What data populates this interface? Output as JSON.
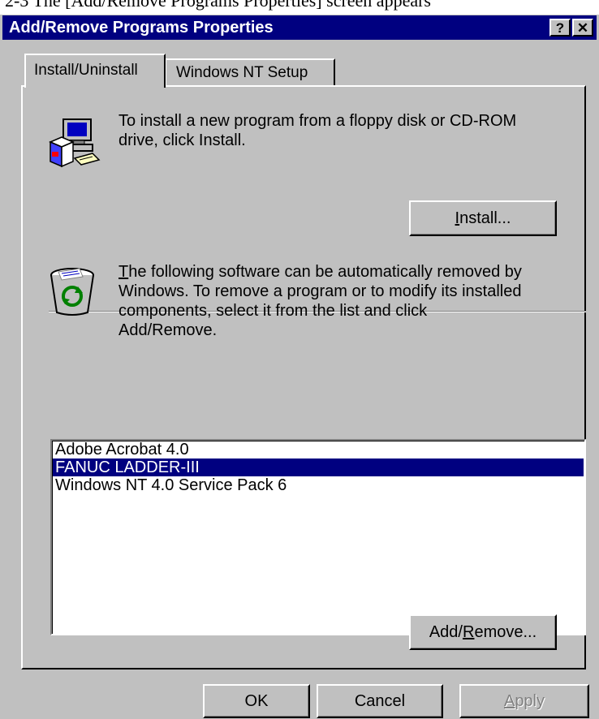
{
  "caption": "2-3    The [Add/Remove Programs Properties] screen appears",
  "window": {
    "title": "Add/Remove Programs Properties",
    "help_glyph": "?",
    "close_glyph": "✕"
  },
  "tabs": [
    {
      "label": "Install/Uninstall",
      "active": true
    },
    {
      "label": "Windows NT Setup",
      "active": false
    }
  ],
  "install_section": {
    "icon": "install-computer-icon",
    "text_line1": "To install a new program from a floppy disk or CD-ROM",
    "text_line2": "drive, click Install.",
    "button": {
      "prefix": "",
      "accel": "I",
      "suffix": "nstall..."
    }
  },
  "remove_section": {
    "icon": "recycle-bin-icon",
    "text_first_letter": "T",
    "text_line1_rest": "he following software can be automatically removed by",
    "text_line2": "Windows. To remove a program or to modify its installed",
    "text_line3": "components, select it from the list and click",
    "text_line4": "Add/Remove.",
    "programs": [
      {
        "name": "Adobe Acrobat 4.0",
        "selected": false
      },
      {
        "name": "FANUC LADDER-III",
        "selected": true
      },
      {
        "name": "Windows NT 4.0 Service Pack 6",
        "selected": false
      }
    ],
    "button": {
      "prefix": "Add/",
      "accel": "R",
      "suffix": "emove..."
    }
  },
  "footer": {
    "ok": "OK",
    "cancel": "Cancel",
    "apply_accel": "A",
    "apply_rest": "pply",
    "apply_enabled": false
  },
  "colors": {
    "titlebar": "#000080",
    "face": "#c0c0c0",
    "selection": "#000080"
  }
}
